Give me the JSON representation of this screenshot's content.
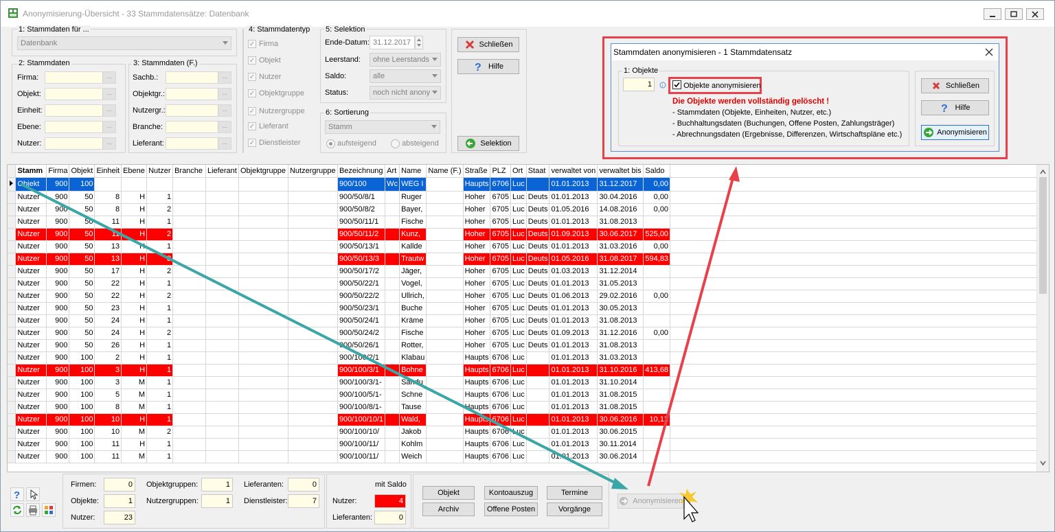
{
  "window": {
    "title": "Anonymisierung-Übersicht - 33 Stammdatensätze: Datenbank"
  },
  "stammdaten_fuer": {
    "label": "1: Stammdaten für ...",
    "value": "Datenbank"
  },
  "stammdaten": {
    "label": "2: Stammdaten",
    "fields": [
      "Firma:",
      "Objekt:",
      "Einheit:",
      "Ebene:",
      "Nutzer:"
    ]
  },
  "stammdaten_f": {
    "label": "3: Stammdaten (F.)",
    "fields": [
      "Sachb.:",
      "Objektgr.:",
      "Nutzergr.:",
      "Branche:",
      "Lieferant:"
    ]
  },
  "stammdatentyp": {
    "label": "4: Stammdatentyp",
    "items": [
      "Firma",
      "Objekt",
      "Nutzer",
      "Objektgruppe",
      "Nutzergruppe",
      "Lieferant",
      "Dienstleister"
    ]
  },
  "selektion": {
    "label": "5: Selektion",
    "ende_datum_label": "Ende-Datum:",
    "ende_datum": "31.12.2017",
    "leerstand_label": "Leerstand:",
    "leerstand": "ohne Leerstands",
    "saldo_label": "Saldo:",
    "saldo": "alle",
    "status_label": "Status:",
    "status": "noch nicht anony"
  },
  "sortierung": {
    "label": "6: Sortierung",
    "value": "Stamm",
    "asc": "aufsteigend",
    "desc": "absteigend"
  },
  "buttons": {
    "schliessen": "Schließen",
    "hilfe": "Hilfe",
    "selektion": "Selektion",
    "anonymisieren": "Anonymisieren"
  },
  "grid": {
    "columns": [
      "Stamm",
      "Firma",
      "Objekt",
      "Einheit",
      "Ebene",
      "Nutzer",
      "Branche",
      "Lieferant",
      "Objektgruppe",
      "Nutzergruppe",
      "Bezeichnung",
      "Art",
      "Name",
      "Name (F.)",
      "Straße",
      "PLZ",
      "Ort",
      "Staat",
      "verwaltet von",
      "verwaltet bis",
      "Saldo"
    ],
    "rows": [
      {
        "c": [
          "Objekt",
          "900",
          "100",
          "",
          "",
          "",
          "",
          "",
          "",
          "",
          "900/100",
          "Wc",
          "WEG I",
          "",
          "Haupts",
          "6706",
          "Luc",
          "",
          "01.01.2013",
          "31.12.2017",
          "0,00"
        ],
        "s": "sel"
      },
      {
        "c": [
          "Nutzer",
          "900",
          "50",
          "8",
          "H",
          "1",
          "",
          "",
          "",
          "",
          "900/50/8/1",
          "",
          "Ruger",
          "",
          "Hoher",
          "6705",
          "Luc",
          "Deuts",
          "01.01.2013",
          "30.04.2016",
          "0,00"
        ],
        "s": ""
      },
      {
        "c": [
          "Nutzer",
          "900",
          "50",
          "8",
          "H",
          "2",
          "",
          "",
          "",
          "",
          "900/50/8/2",
          "",
          "Bayer,",
          "",
          "Hoher",
          "6705",
          "Luc",
          "Deuts",
          "01.05.2016",
          "14.08.2016",
          "0,00"
        ],
        "s": ""
      },
      {
        "c": [
          "Nutzer",
          "900",
          "50",
          "11",
          "H",
          "1",
          "",
          "",
          "",
          "",
          "900/50/11/1",
          "",
          "Fische",
          "",
          "Hoher",
          "6705",
          "Luc",
          "Deuts",
          "01.01.2013",
          "31.08.2013",
          ""
        ],
        "s": ""
      },
      {
        "c": [
          "Nutzer",
          "900",
          "50",
          "11",
          "H",
          "2",
          "",
          "",
          "",
          "",
          "900/50/11/2",
          "",
          "Kunz,",
          "",
          "Hoher",
          "6705",
          "Luc",
          "Deuts",
          "01.09.2013",
          "30.06.2017",
          "525,00"
        ],
        "s": "red"
      },
      {
        "c": [
          "Nutzer",
          "900",
          "50",
          "13",
          "H",
          "1",
          "",
          "",
          "",
          "",
          "900/50/13/1",
          "",
          "Kallde",
          "",
          "Hoher",
          "6705",
          "Luc",
          "Deuts",
          "01.01.2013",
          "31.03.2016",
          "0,00"
        ],
        "s": ""
      },
      {
        "c": [
          "Nutzer",
          "900",
          "50",
          "13",
          "H",
          "3",
          "",
          "",
          "",
          "",
          "900/50/13/3",
          "",
          "Trautw",
          "",
          "Hoher",
          "6705",
          "Luc",
          "Deuts",
          "01.05.2016",
          "31.08.2017",
          "594,83"
        ],
        "s": "red"
      },
      {
        "c": [
          "Nutzer",
          "900",
          "50",
          "17",
          "H",
          "2",
          "",
          "",
          "",
          "",
          "900/50/17/2",
          "",
          "Jäger,",
          "",
          "Hoher",
          "6705",
          "Luc",
          "Deuts",
          "01.03.2013",
          "31.12.2014",
          ""
        ],
        "s": ""
      },
      {
        "c": [
          "Nutzer",
          "900",
          "50",
          "22",
          "H",
          "1",
          "",
          "",
          "",
          "",
          "900/50/22/1",
          "",
          "Vogel,",
          "",
          "Hoher",
          "6705",
          "Luc",
          "Deuts",
          "01.01.2013",
          "31.05.2013",
          ""
        ],
        "s": ""
      },
      {
        "c": [
          "Nutzer",
          "900",
          "50",
          "22",
          "H",
          "2",
          "",
          "",
          "",
          "",
          "900/50/22/2",
          "",
          "Ullrich,",
          "",
          "Hoher",
          "6705",
          "Luc",
          "Deuts",
          "01.06.2013",
          "29.02.2016",
          "0,00"
        ],
        "s": ""
      },
      {
        "c": [
          "Nutzer",
          "900",
          "50",
          "23",
          "H",
          "1",
          "",
          "",
          "",
          "",
          "900/50/23/1",
          "",
          "Buche",
          "",
          "Hoher",
          "6705",
          "Luc",
          "Deuts",
          "01.01.2013",
          "30.05.2013",
          ""
        ],
        "s": ""
      },
      {
        "c": [
          "Nutzer",
          "900",
          "50",
          "24",
          "H",
          "1",
          "",
          "",
          "",
          "",
          "900/50/24/1",
          "",
          "Kräme",
          "",
          "Hoher",
          "6705",
          "Luc",
          "Deuts",
          "01.01.2013",
          "31.08.2013",
          ""
        ],
        "s": ""
      },
      {
        "c": [
          "Nutzer",
          "900",
          "50",
          "24",
          "H",
          "2",
          "",
          "",
          "",
          "",
          "900/50/24/2",
          "",
          "Fische",
          "",
          "Hoher",
          "6705",
          "Luc",
          "Deuts",
          "01.09.2013",
          "31.12.2016",
          "0,00"
        ],
        "s": ""
      },
      {
        "c": [
          "Nutzer",
          "900",
          "50",
          "26",
          "H",
          "1",
          "",
          "",
          "",
          "",
          "900/50/26/1",
          "",
          "Rotter,",
          "",
          "Hoher",
          "6705",
          "Luc",
          "Deuts",
          "01.01.2013",
          "31.08.2013",
          ""
        ],
        "s": ""
      },
      {
        "c": [
          "Nutzer",
          "900",
          "100",
          "2",
          "H",
          "1",
          "",
          "",
          "",
          "",
          "900/100/2/1",
          "",
          "Klabau",
          "",
          "Haupts",
          "6706",
          "Luc",
          "",
          "01.01.2013",
          "31.03.2013",
          ""
        ],
        "s": ""
      },
      {
        "c": [
          "Nutzer",
          "900",
          "100",
          "3",
          "H",
          "1",
          "",
          "",
          "",
          "",
          "900/100/3/1",
          "",
          "Bohne",
          "",
          "Haupts",
          "6706",
          "Luc",
          "",
          "01.01.2013",
          "31.10.2016",
          "413,68"
        ],
        "s": "red"
      },
      {
        "c": [
          "Nutzer",
          "900",
          "100",
          "3",
          "M",
          "1",
          "",
          "",
          "",
          "",
          "900/100/3/1-",
          "",
          "Sandu",
          "",
          "Haupts",
          "6706",
          "Luc",
          "",
          "01.01.2013",
          "31.10.2014",
          ""
        ],
        "s": ""
      },
      {
        "c": [
          "Nutzer",
          "900",
          "100",
          "5",
          "M",
          "1",
          "",
          "",
          "",
          "",
          "900/100/5/1-",
          "",
          "Schne",
          "",
          "Haupts",
          "6706",
          "Luc",
          "",
          "01.01.2013",
          "31.08.2015",
          ""
        ],
        "s": ""
      },
      {
        "c": [
          "Nutzer",
          "900",
          "100",
          "8",
          "M",
          "1",
          "",
          "",
          "",
          "",
          "900/100/8/1-",
          "",
          "Tause",
          "",
          "Haupts",
          "6706",
          "Luc",
          "",
          "01.01.2013",
          "31.08.2015",
          ""
        ],
        "s": ""
      },
      {
        "c": [
          "Nutzer",
          "900",
          "100",
          "10",
          "H",
          "1",
          "",
          "",
          "",
          "",
          "900/100/10/1",
          "",
          "Wald,",
          "",
          "Haupts",
          "6706",
          "Luc",
          "",
          "01.01.2013",
          "30.06.2016",
          "10,12"
        ],
        "s": "red"
      },
      {
        "c": [
          "Nutzer",
          "900",
          "100",
          "10",
          "M",
          "2",
          "",
          "",
          "",
          "",
          "900/100/10/",
          "",
          "Jakob",
          "",
          "Haupts",
          "6706",
          "Luc",
          "",
          "01.01.2013",
          "30.06.2015",
          ""
        ],
        "s": ""
      },
      {
        "c": [
          "Nutzer",
          "900",
          "100",
          "11",
          "H",
          "1",
          "",
          "",
          "",
          "",
          "900/100/11/",
          "",
          "Kohlm",
          "",
          "Haupts",
          "6706",
          "Luc",
          "",
          "01.01.2013",
          "30.11.2014",
          ""
        ],
        "s": ""
      },
      {
        "c": [
          "Nutzer",
          "900",
          "100",
          "11",
          "M",
          "1",
          "",
          "",
          "",
          "",
          "900/100/11/",
          "",
          "Weich",
          "",
          "Haupts",
          "6706",
          "Luc",
          "",
          "01.01.2013",
          "30.06.2014",
          ""
        ],
        "s": ""
      }
    ]
  },
  "counts": {
    "firmen_label": "Firmen:",
    "firmen": "0",
    "objekte_label": "Objekte:",
    "objekte": "1",
    "nutzer_label": "Nutzer:",
    "nutzer": "23",
    "objektgruppen_label": "Objektgruppen:",
    "objektgruppen": "1",
    "nutzergruppen_label": "Nutzergruppen:",
    "nutzergruppen": "1",
    "lieferanten_label": "Lieferanten:",
    "lieferanten": "0",
    "dienstleister_label": "Dienstleister:",
    "dienstleister": "7"
  },
  "saldo_box": {
    "title": "mit Saldo",
    "nutzer_label": "Nutzer:",
    "nutzer": "4",
    "lieferanten_label": "Lieferanten:",
    "lieferanten": "0"
  },
  "nav_buttons": {
    "objekt": "Objekt",
    "kontoauszug": "Kontoauszug",
    "termine": "Termine",
    "archiv": "Archiv",
    "offene_posten": "Offene Posten",
    "vorgaenge": "Vorgänge"
  },
  "dialog": {
    "title": "Stammdaten anonymisieren - 1 Stammdatensatz",
    "objekte_label": "1: Objekte",
    "objekte_value": "1",
    "checkbox_label": "Objekte anonymisieren",
    "warning": "Die Objekte werden vollständig gelöscht !",
    "bullets": [
      "- Stammdaten (Objekte, Einheiten, Nutzer, etc.)",
      "- Buchhaltungsdaten (Buchungen, Offene Posten, Zahlungsträger)",
      "- Abrechnungsdaten (Ergebnisse, Differenzen, Wirtschaftspläne etc.)"
    ],
    "btn_schliessen": "Schließen",
    "btn_hilfe": "Hilfe",
    "btn_anonymisieren": "Anonymisieren"
  },
  "colors": {
    "highlight_red": "#ff0000",
    "annotation_red": "#e8414b",
    "arrow_teal": "#3aa6a6",
    "selection_blue": "#0a64d6"
  }
}
